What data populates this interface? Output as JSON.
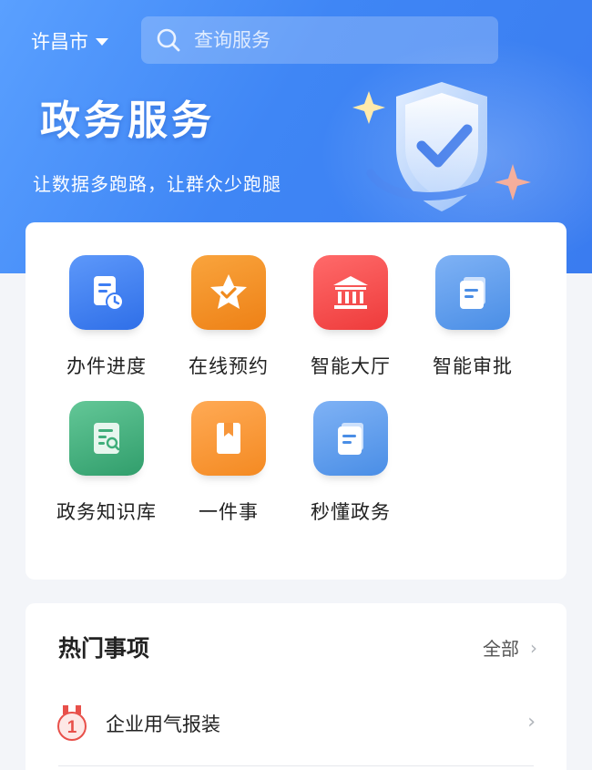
{
  "header": {
    "city": "许昌市",
    "search_placeholder": "查询服务",
    "title": "政务服务",
    "subtitle": "让数据多跑路，让群众少跑腿"
  },
  "services": [
    {
      "label": "办件进度",
      "icon": "document-clock-icon",
      "color": "#3d7df3"
    },
    {
      "label": "在线预约",
      "icon": "star-check-icon",
      "color": "#f08a1c"
    },
    {
      "label": "智能大厅",
      "icon": "bank-building-icon",
      "color": "#f24a4a"
    },
    {
      "label": "智能审批",
      "icon": "document-icon",
      "color": "#4a90e8"
    },
    {
      "label": "政务知识库",
      "icon": "document-search-icon",
      "color": "#3fae7a"
    },
    {
      "label": "一件事",
      "icon": "bookmark-book-icon",
      "color": "#f7963a"
    },
    {
      "label": "秒懂政务",
      "icon": "document-stack-icon",
      "color": "#4a90e8"
    }
  ],
  "hot": {
    "title": "热门事项",
    "all_label": "全部",
    "items": [
      {
        "rank": "1",
        "label": "企业用气报装"
      }
    ]
  }
}
